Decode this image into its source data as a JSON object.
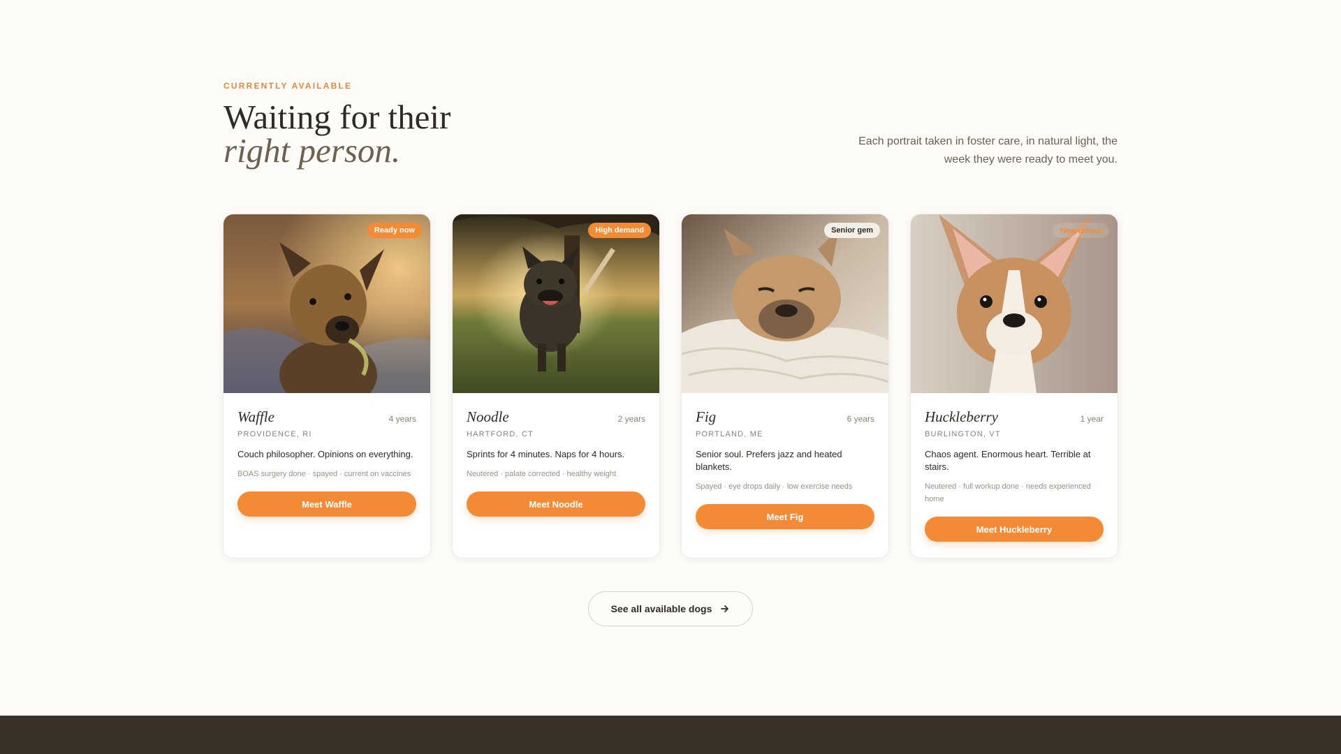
{
  "header": {
    "eyebrow": "CURRENTLY AVAILABLE",
    "title_line1": "Waiting for their",
    "title_line2": "right person.",
    "intro_line1": "Each portrait taken in foster care, in natural light, the",
    "intro_line2": "week they were ready to meet you."
  },
  "dogs": [
    {
      "name": "Waffle",
      "age": "4 years",
      "location": "PROVIDENCE, RI",
      "blurb": "Couch philosopher. Opinions on everything.",
      "tags": "BOAS surgery done · spayed · current on vaccines",
      "badge": "Ready now",
      "button": "Meet Waffle",
      "photo_icon": "dog-portrait-image"
    },
    {
      "name": "Noodle",
      "age": "2 years",
      "location": "HARTFORD, CT",
      "blurb": "Sprints for 4 minutes. Naps for 4 hours.",
      "tags": "Neutered · palate corrected · healthy weight",
      "badge": "High demand",
      "button": "Meet Noodle",
      "photo_icon": "dog-portrait-image"
    },
    {
      "name": "Fig",
      "age": "6 years",
      "location": "PORTLAND, ME",
      "blurb": "Senior soul. Prefers jazz and heated blankets.",
      "tags": "Spayed · eye drops daily · low exercise needs",
      "badge": "Senior gem",
      "button": "Meet Fig",
      "photo_icon": "dog-portrait-image"
    },
    {
      "name": "Huckleberry",
      "age": "1 year",
      "location": "BURLINGTON, VT",
      "blurb": "Chaos agent. Enormous heart. Terrible at stairs.",
      "tags": "Neutered · full workup done · needs experienced home",
      "badge": "New arrival",
      "button": "Meet Huckleberry",
      "photo_icon": "dog-portrait-image"
    }
  ],
  "see_all": {
    "label": "See all available dogs",
    "icon": "arrow-right-icon"
  },
  "colors": {
    "accent": "#f28a36",
    "eyebrow": "#e08a3c",
    "background": "#fcfbf7",
    "footer": "#3a3128"
  }
}
